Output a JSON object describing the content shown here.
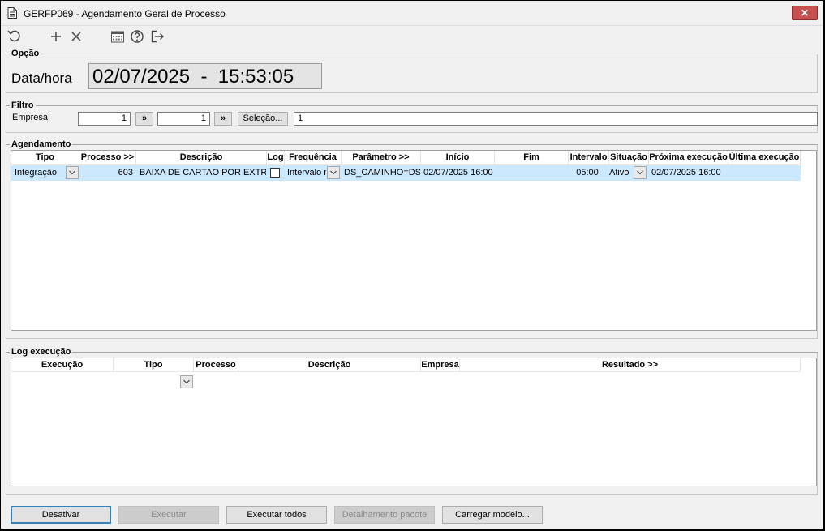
{
  "window": {
    "title": "GERFP069 - Agendamento Geral de Processo",
    "close_label": "✕"
  },
  "toolbar": {
    "icons": [
      "refresh-icon",
      "add-icon",
      "delete-icon",
      "calendar-icon",
      "help-icon",
      "exit-icon"
    ]
  },
  "opcao": {
    "legend": "Opção",
    "datahora_label": "Data/hora",
    "datahora_value": "02/07/2025  -  15:53:05"
  },
  "filtro": {
    "legend": "Filtro",
    "empresa_label": "Empresa",
    "from_value": "1",
    "to_value": "1",
    "nav_label": "»",
    "selecao_label": "Seleção...",
    "selection_value": "1"
  },
  "agendamento": {
    "legend": "Agendamento",
    "columns": [
      "Tipo",
      "Processo >>",
      "Descrição",
      "Log",
      "Frequência",
      "Parâmetro >>",
      "Início",
      "Fim",
      "Intervalo",
      "Situação",
      "Próxima execução",
      "Última execução"
    ],
    "rows": [
      {
        "tipo": "Integração",
        "processo": "603",
        "descricao": "BAIXA DE CARTAO POR EXTRATO",
        "log": false,
        "frequencia": "Intervalo m",
        "parametro": "DS_CAMINHO=DS_",
        "inicio": "02/07/2025 16:00",
        "fim": "",
        "intervalo": "05:00",
        "situacao": "Ativo",
        "proxima": "02/07/2025 16:00",
        "ultima": ""
      }
    ]
  },
  "log_execucao": {
    "legend": "Log execução",
    "columns": [
      "Execução",
      "Tipo",
      "Processo",
      "Descrição",
      "Empresa",
      "Resultado >>"
    ]
  },
  "buttons": {
    "desativar": "Desativar",
    "executar": "Executar",
    "executar_todos": "Executar todos",
    "detalhamento": "Detalhamento pacote",
    "carregar": "Carregar modelo..."
  },
  "colors": {
    "selected_row": "#cce8ff",
    "close_button": "#c75050",
    "primary_border": "#3c7fb1"
  }
}
